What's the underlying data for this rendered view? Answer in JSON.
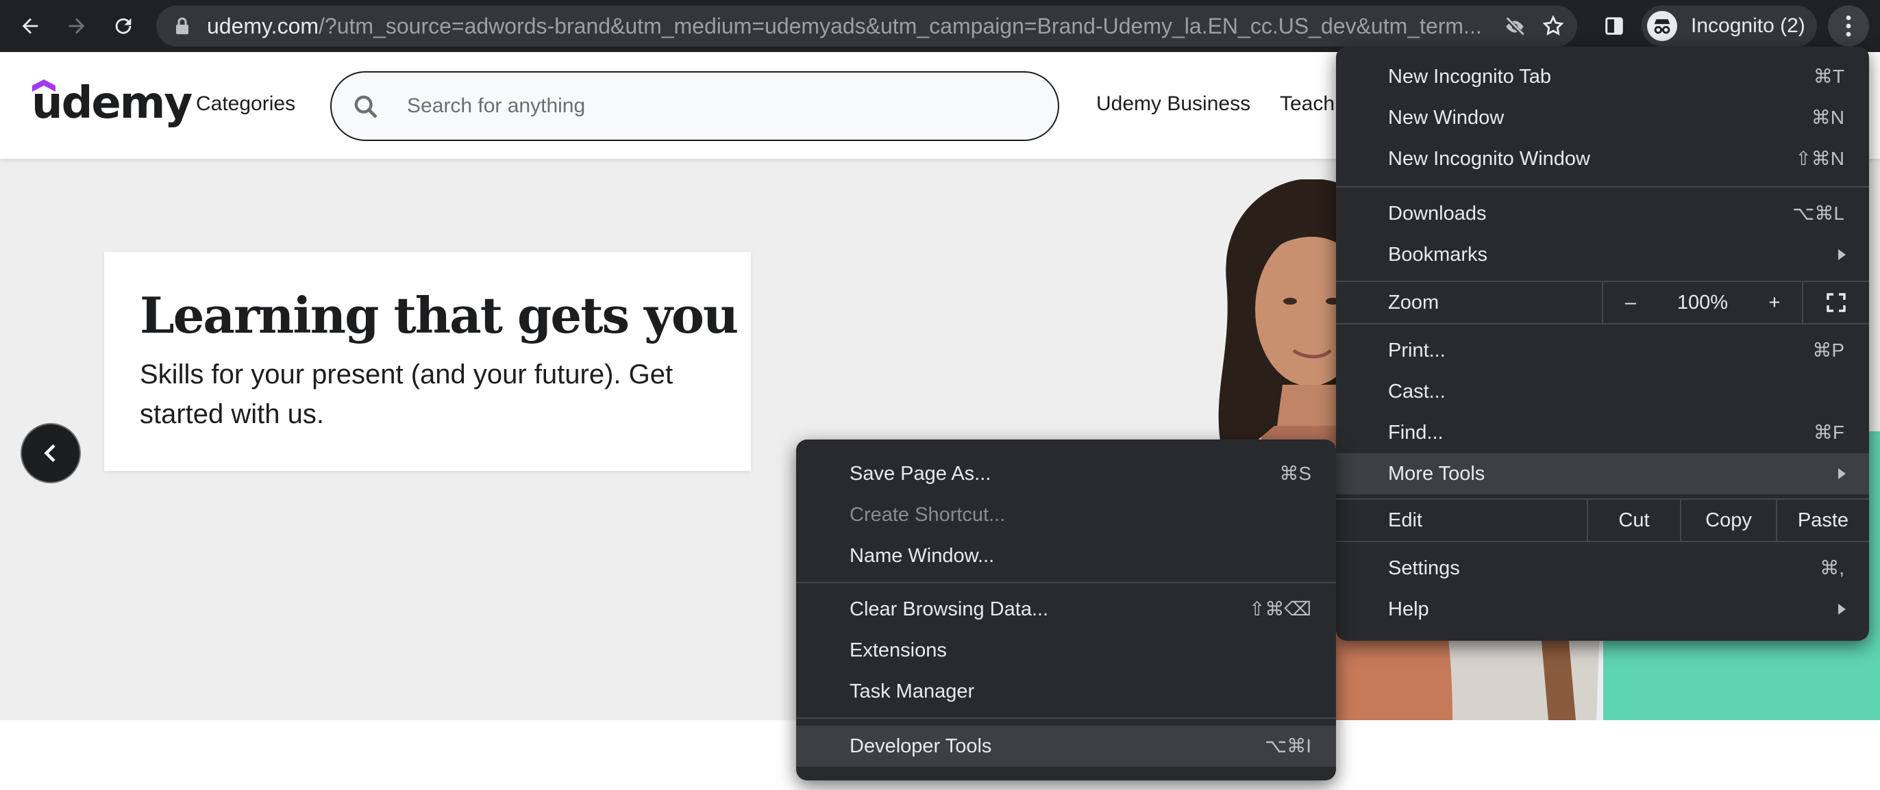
{
  "browser": {
    "url_host": "udemy.com",
    "url_rest": "/?utm_source=adwords-brand&utm_medium=udemyads&utm_campaign=Brand-Udemy_la.EN_cc.US_dev&utm_term...",
    "profile_label": "Incognito (2)"
  },
  "header": {
    "logo": "udemy",
    "categories": "Categories",
    "search_placeholder": "Search for anything",
    "nav": [
      "Udemy Business",
      "Teach"
    ]
  },
  "hero": {
    "title": "Learning that gets you",
    "subtitle": "Skills for your present (and your future). Get started with us."
  },
  "chrome_menu": {
    "new_incognito_tab": {
      "label": "New Incognito Tab",
      "shortcut": "⌘T"
    },
    "new_window": {
      "label": "New Window",
      "shortcut": "⌘N"
    },
    "new_incognito_window": {
      "label": "New Incognito Window",
      "shortcut": "⇧⌘N"
    },
    "downloads": {
      "label": "Downloads",
      "shortcut": "⌥⌘L"
    },
    "bookmarks": {
      "label": "Bookmarks"
    },
    "zoom": {
      "label": "Zoom",
      "minus": "–",
      "value": "100%",
      "plus": "+"
    },
    "print": {
      "label": "Print...",
      "shortcut": "⌘P"
    },
    "cast": {
      "label": "Cast..."
    },
    "find": {
      "label": "Find...",
      "shortcut": "⌘F"
    },
    "more_tools": {
      "label": "More Tools"
    },
    "edit": {
      "label": "Edit",
      "cut": "Cut",
      "copy": "Copy",
      "paste": "Paste"
    },
    "settings": {
      "label": "Settings",
      "shortcut": "⌘,"
    },
    "help": {
      "label": "Help"
    }
  },
  "more_tools_menu": {
    "save_page": {
      "label": "Save Page As...",
      "shortcut": "⌘S"
    },
    "create_shortcut": {
      "label": "Create Shortcut..."
    },
    "name_window": {
      "label": "Name Window..."
    },
    "clear_data": {
      "label": "Clear Browsing Data...",
      "shortcut": "⇧⌘⌫"
    },
    "extensions": {
      "label": "Extensions"
    },
    "task_manager": {
      "label": "Task Manager"
    },
    "dev_tools": {
      "label": "Developer Tools",
      "shortcut": "⌥⌘I"
    }
  },
  "colors": {
    "toolbar": "#202124",
    "menu_bg": "#292a2d",
    "menu_highlight": "#3e3f42",
    "udemy_purple": "#a435f0",
    "hero_teal": "#5fd4b2"
  }
}
